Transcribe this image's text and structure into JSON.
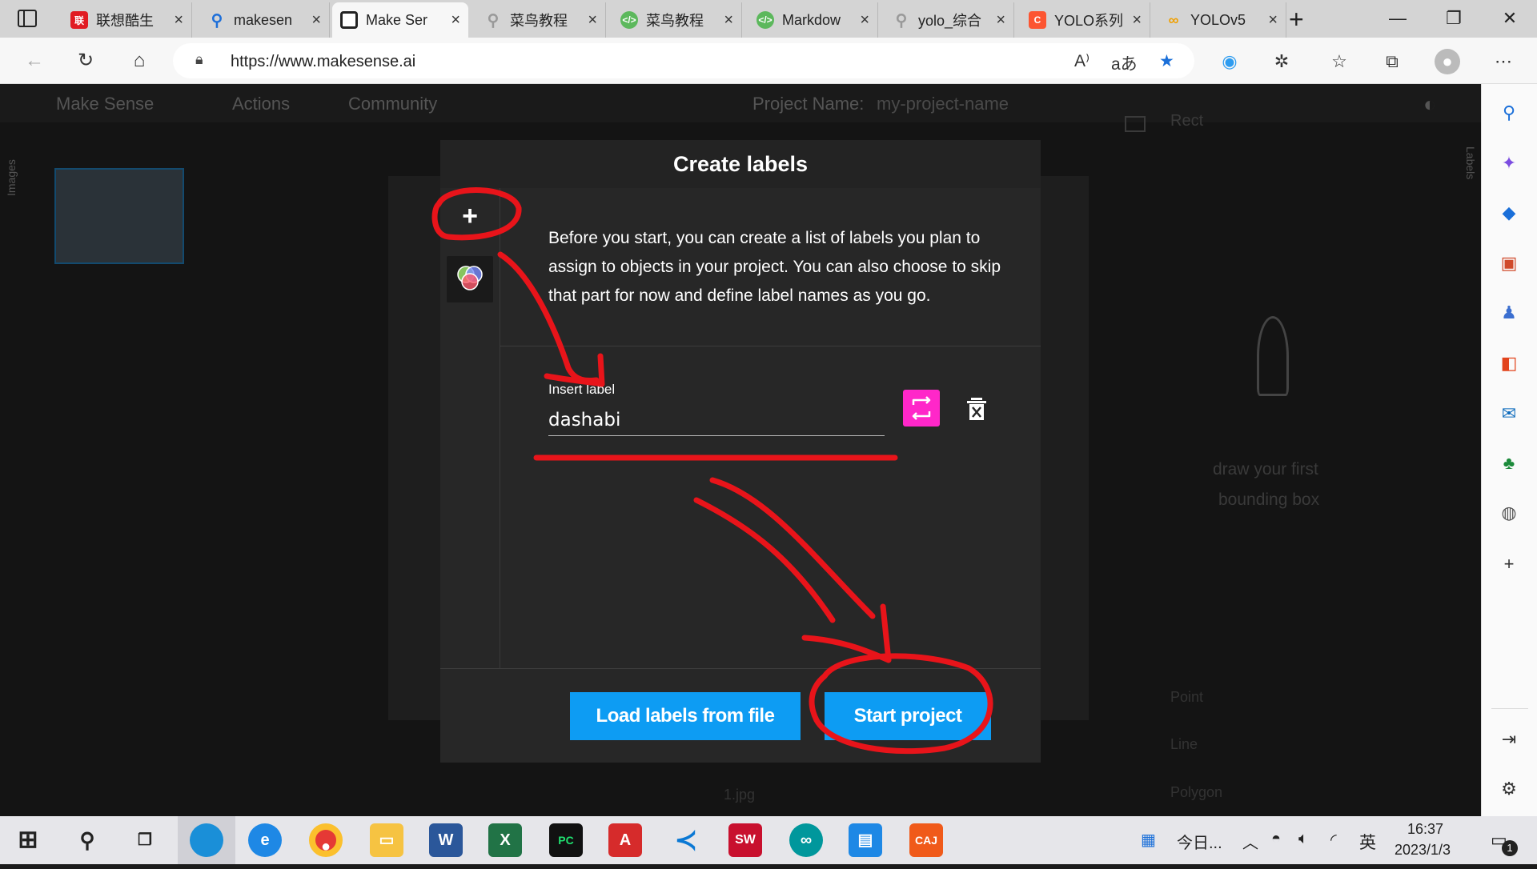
{
  "browser": {
    "tabs": [
      {
        "label": "联想酷生",
        "icon": "lenovo-icon",
        "color": "#e11b22"
      },
      {
        "label": "makesen",
        "icon": "search-icon",
        "color": "#1e6fd9"
      },
      {
        "label": "Make Ser",
        "icon": "makesense-icon",
        "color": "#222222",
        "active": true
      },
      {
        "label": "菜鸟教程",
        "icon": "search-icon",
        "color": "#999999"
      },
      {
        "label": "菜鸟教程",
        "icon": "runoob-icon",
        "color": "#5cb85c"
      },
      {
        "label": "Markdow",
        "icon": "runoob-icon",
        "color": "#5cb85c"
      },
      {
        "label": "yolo_综合",
        "icon": "search-icon",
        "color": "#999999"
      },
      {
        "label": "YOLO系列",
        "icon": "csdn-icon",
        "color": "#fc5531"
      },
      {
        "label": "YOLOv5",
        "icon": "link-icon",
        "color": "#f0a000"
      }
    ],
    "new_tab": "+",
    "url": "https://www.makesense.ai"
  },
  "app_background": {
    "logo": "Make Sense",
    "actions": "Actions",
    "community": "Community",
    "project_name_label": "Project Name:",
    "project_name_value": "my-project-name",
    "images_label": "Images",
    "labels_label": "Labels",
    "rect": "Rect",
    "point": "Point",
    "line": "Line",
    "polygon": "Polygon",
    "hint_line1": "draw your first",
    "hint_line2": "bounding box",
    "image_name": "1.jpg"
  },
  "modal": {
    "title": "Create labels",
    "add_symbol": "+",
    "description": "Before you start, you can create a list of labels you plan to assign to objects in your project. You can also choose to skip that part for now and define label names as you go.",
    "input_label": "Insert label",
    "input_value": "dashabi",
    "load_button": "Load labels from file",
    "start_button": "Start project"
  },
  "taskbar": {
    "widget_text": "今日...",
    "ime": "英",
    "time": "16:37",
    "date": "2023/1/3",
    "notification_count": "1"
  }
}
